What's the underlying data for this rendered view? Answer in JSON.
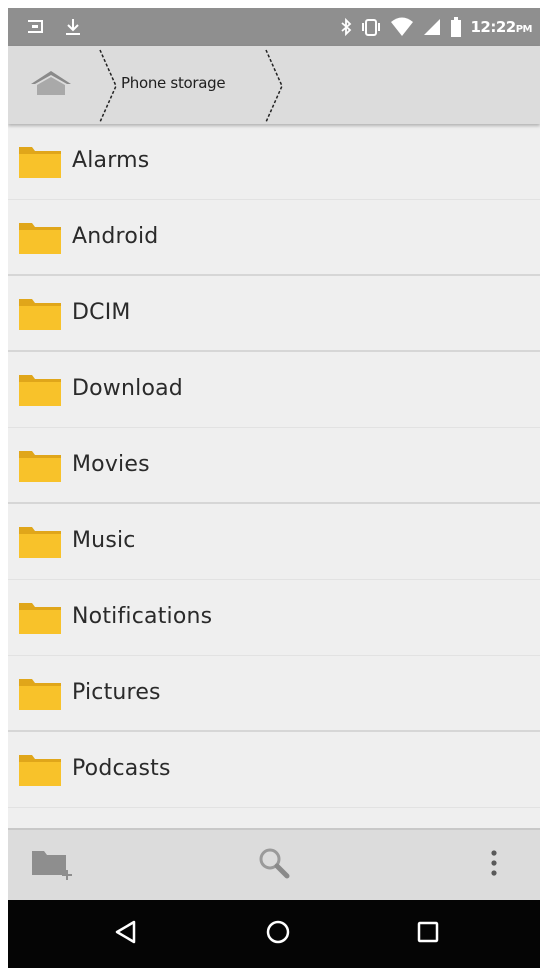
{
  "status_bar": {
    "time": "12:22",
    "ampm": "PM",
    "icons": [
      "notification-sim-icon",
      "download-icon",
      "bluetooth-icon",
      "vibrate-icon",
      "wifi-icon",
      "signal-icon",
      "battery-icon"
    ]
  },
  "breadcrumb": {
    "home_icon": "home-icon",
    "items": [
      {
        "label": "Phone storage"
      }
    ]
  },
  "folders": [
    {
      "name": "Alarms"
    },
    {
      "name": "Android"
    },
    {
      "name": "DCIM"
    },
    {
      "name": "Download"
    },
    {
      "name": "Movies"
    },
    {
      "name": "Music"
    },
    {
      "name": "Notifications"
    },
    {
      "name": "Pictures"
    },
    {
      "name": "Podcasts"
    },
    {
      "name": ""
    }
  ],
  "toolbar": {
    "new_folder_icon": "new-folder-icon",
    "search_icon": "search-icon",
    "menu_icon": "more-vert-icon"
  },
  "nav": {
    "back_icon": "back-icon",
    "home_icon": "nav-home-icon",
    "recents_icon": "recents-icon"
  },
  "colors": {
    "status_bar": "#8f8f8f",
    "breadcrumb_bar": "#dcdcdc",
    "list_bg": "#efefef",
    "folder_body": "#f8c22a",
    "folder_tab": "#e0a61a",
    "nav_bar": "#050505"
  }
}
